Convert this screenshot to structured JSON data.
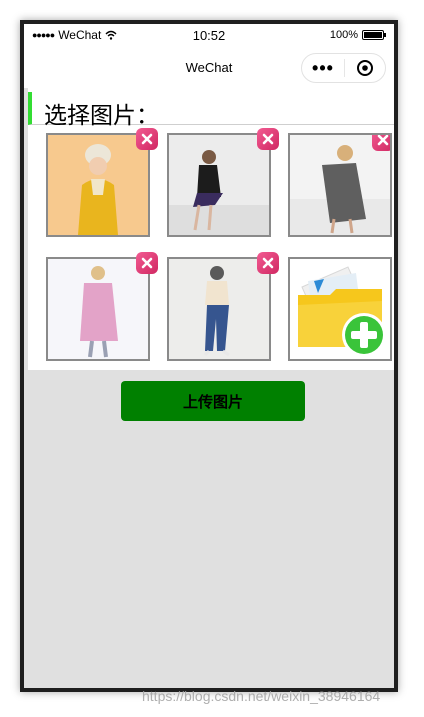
{
  "status_bar": {
    "signal": "●●●●●",
    "carrier": "WeChat",
    "time": "10:52",
    "battery": "100%"
  },
  "nav": {
    "title": "WeChat",
    "more_label": "•••"
  },
  "section": {
    "title": "选择图片："
  },
  "images": [
    {
      "alt": "woman in yellow knit hat and yellow coat"
    },
    {
      "alt": "woman in black blazer seated"
    },
    {
      "alt": "woman in grey coat seated"
    },
    {
      "alt": "woman in pink coat"
    },
    {
      "alt": "woman in jeans and cap"
    }
  ],
  "add_tile": {
    "icon": "folder-add-icon"
  },
  "upload_button": {
    "label": "上传图片"
  },
  "watermark": "https://blog.csdn.net/weixin_38946164",
  "colors": {
    "accent_bar": "#33dd33",
    "upload_button_bg": "#008000",
    "delete_badge": "#e03a74",
    "page_bg": "#e0e0e0"
  }
}
